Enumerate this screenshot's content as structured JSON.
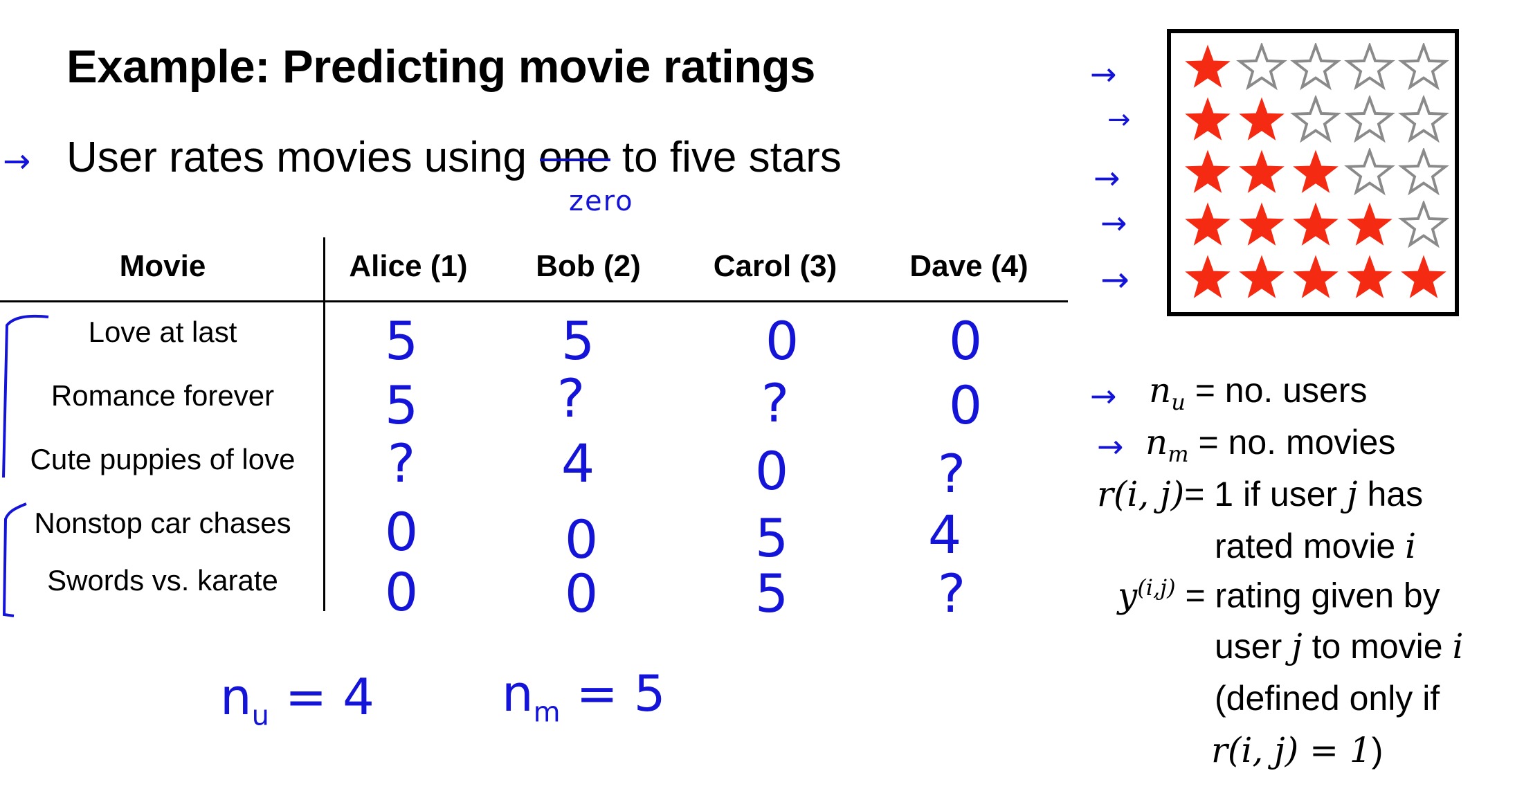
{
  "slide": {
    "title": "Example: Predicting movie ratings",
    "bullet_before": "User rates movies using ",
    "bullet_struck": "one",
    "bullet_after": " to five stars",
    "correction": "zero",
    "arrow": "→"
  },
  "table": {
    "headers": [
      "Movie",
      "Alice (1)",
      "Bob (2)",
      "Carol (3)",
      "Dave (4)"
    ],
    "rows": [
      {
        "movie": "Love at last",
        "ratings": [
          "5",
          "5",
          "0",
          "0"
        ]
      },
      {
        "movie": "Romance forever",
        "ratings": [
          "5",
          "?",
          "?",
          "0"
        ]
      },
      {
        "movie": "Cute puppies of love",
        "ratings": [
          "?",
          "4",
          "0",
          "?"
        ]
      },
      {
        "movie": "Nonstop car chases",
        "ratings": [
          "0",
          "0",
          "5",
          "4"
        ]
      },
      {
        "movie": "Swords vs. karate",
        "ratings": [
          "0",
          "0",
          "5",
          "?"
        ]
      }
    ]
  },
  "handwritten": {
    "nu": "n",
    "nu_sub": "u",
    "nu_val": " = 4",
    "nm": "n",
    "nm_sub": "m",
    "nm_val": " = 5"
  },
  "star_rows": [
    1,
    2,
    3,
    4,
    5
  ],
  "colors": {
    "filled_star": "#f52a12",
    "empty_star": "#8a8a8a",
    "pen": "#1414d8"
  },
  "notation": {
    "nu_sym": "n",
    "nu_sub": "u",
    "nu_def": "= no. users",
    "nm_sym": "n",
    "nm_sub": "m",
    "nm_def": "= no. movies",
    "r_sym": "r(i, j)",
    "r_def_1a": "= 1 if user ",
    "r_def_1j": "j",
    "r_def_1b": " has",
    "r_def_2a": "rated movie ",
    "r_def_2i": "i",
    "y_sym": "y",
    "y_sup": "(i,j)",
    "y_def_1": "= rating given by",
    "y_def_2a": "user ",
    "y_def_2j": "j",
    "y_def_2b": " to movie ",
    "y_def_2i": "i",
    "y_def_3": "(defined only if",
    "y_def_4m": "r(i, j) = 1",
    "y_def_4b": ")"
  }
}
